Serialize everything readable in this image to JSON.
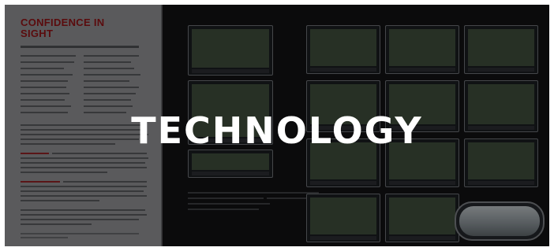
{
  "banner": {
    "heading": "TECHNOLOGY"
  },
  "brochure": {
    "page_title": "CONFIDENCE IN SIGHT"
  },
  "colors": {
    "heading": "#ffffff",
    "title_red": "#8a1214",
    "dark_page": "#111113",
    "light_page": "#8a8b8e"
  }
}
